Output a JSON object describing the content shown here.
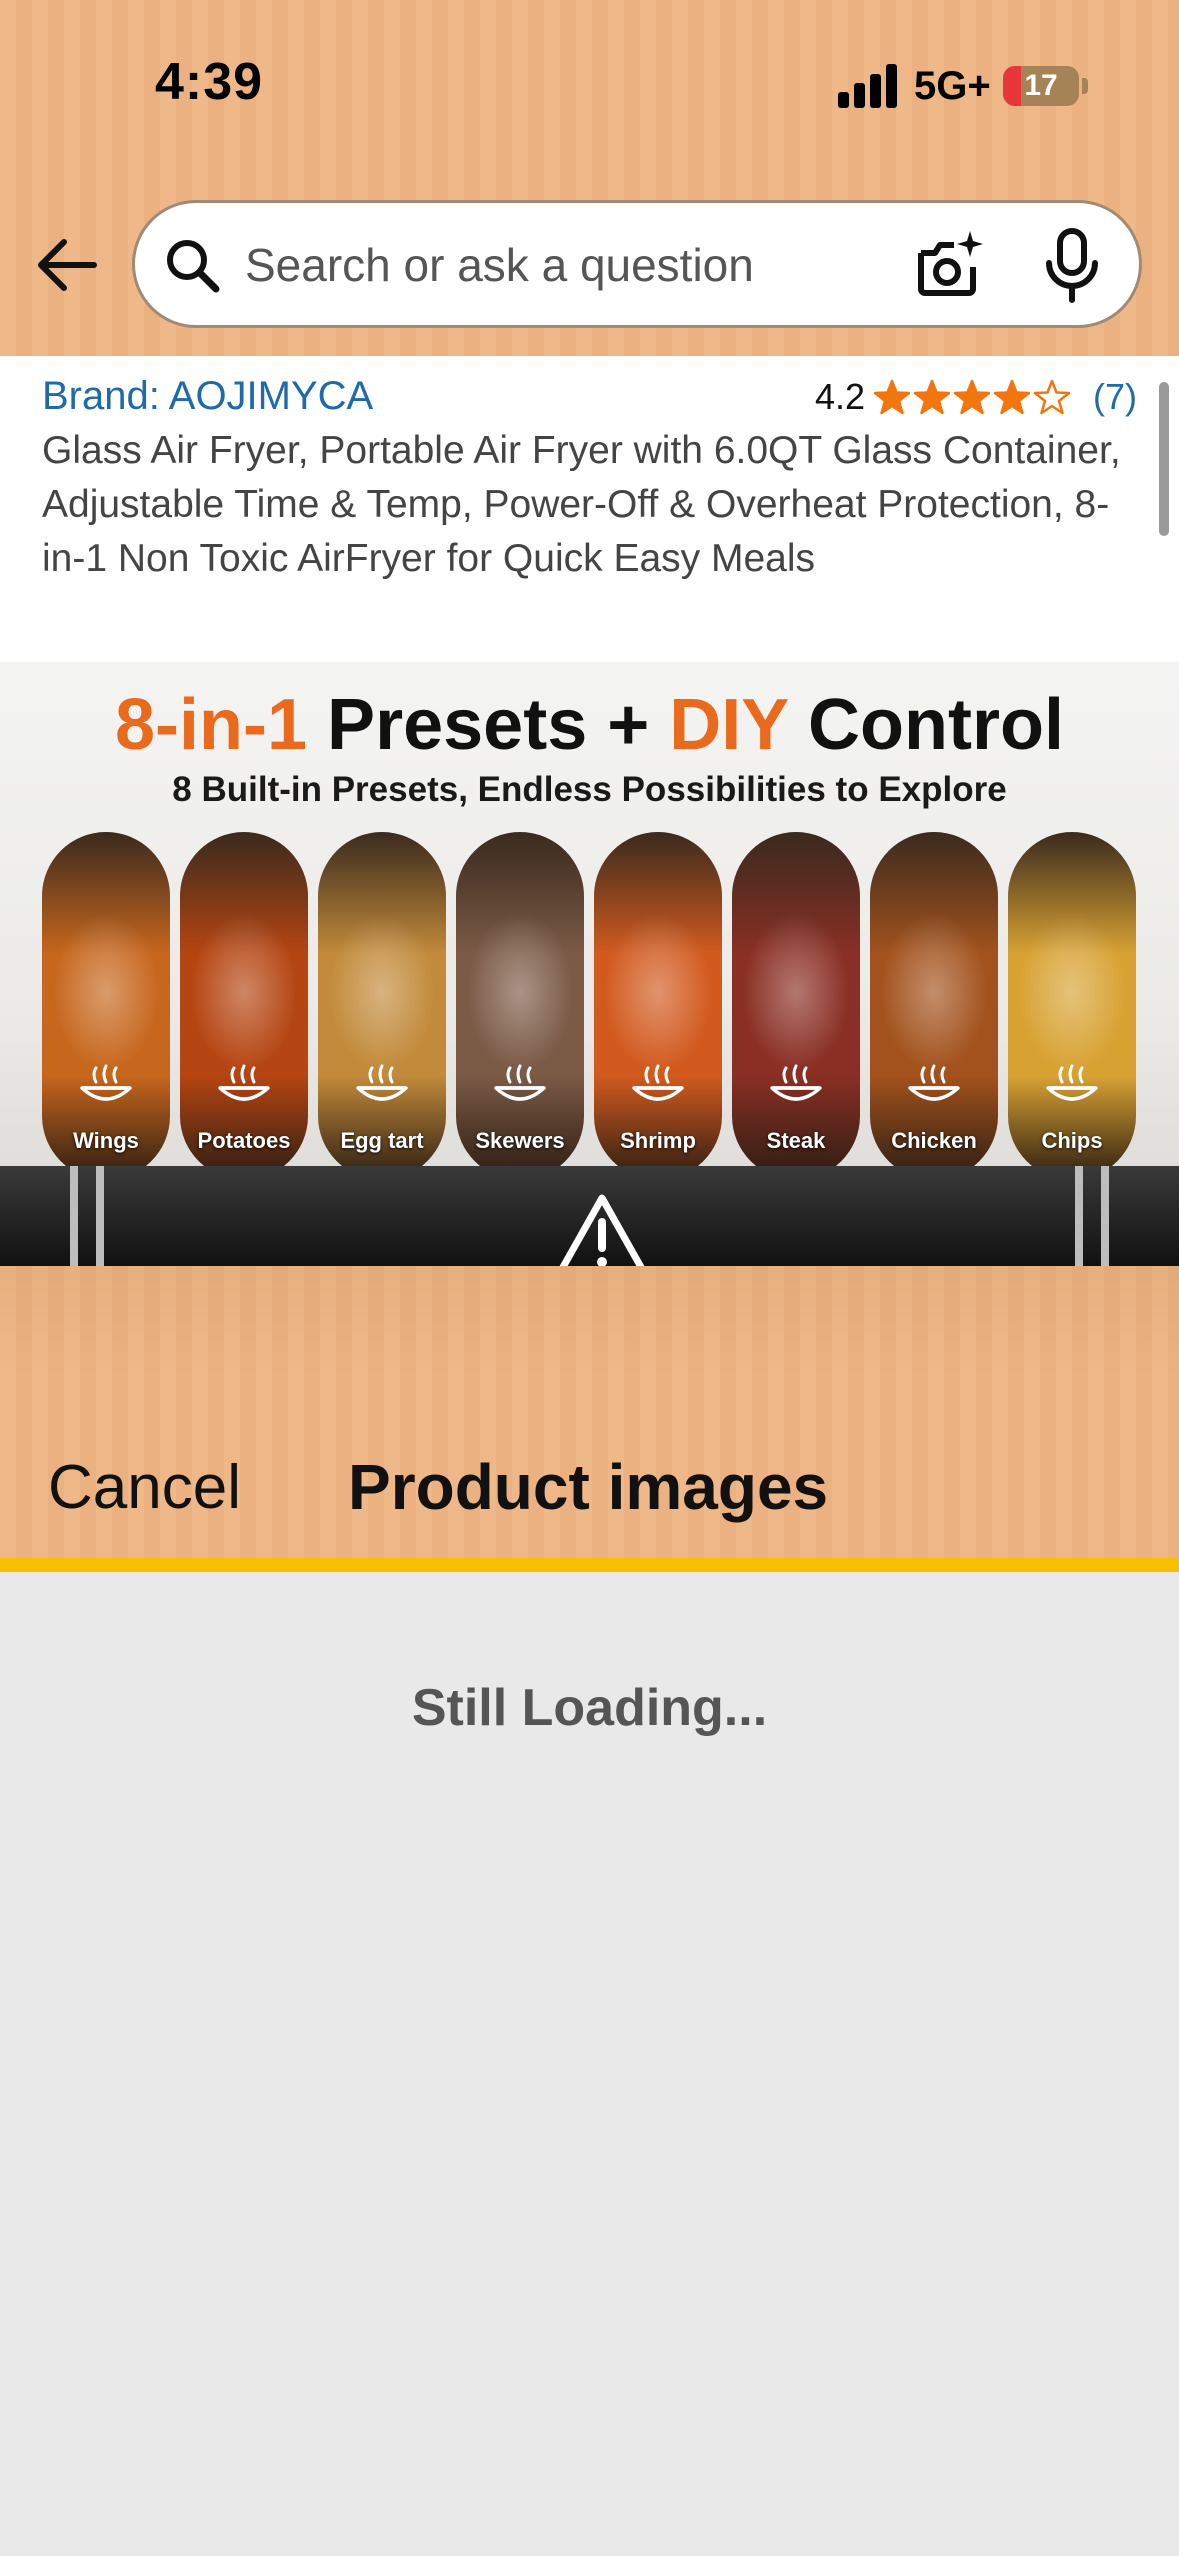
{
  "status_bar": {
    "time": "4:39",
    "network": "5G+",
    "battery": "17",
    "battery_color": "#e8373b"
  },
  "header": {
    "search_placeholder": "Search or ask a question",
    "back_icon": "arrow-left-icon",
    "camera_icon": "camera-sparkle-icon",
    "mic_icon": "microphone-icon"
  },
  "product": {
    "brand": "Brand: AOJIMYCA",
    "rating_value": "4.2",
    "stars_filled": 4,
    "stars_total": 5,
    "review_count": "(7)",
    "title": "Glass Air Fryer, Portable Air Fryer with 6.0QT Glass Container, Adjustable Time & Temp, Power-Off & Overheat Protection, 8-in-1 Non Toxic AirFryer for Quick Easy Meals",
    "star_color": "#f2760d",
    "link_color": "#1f6aa9"
  },
  "hero_image": {
    "title_a": "8-in-1",
    "title_b": " Presets + ",
    "title_c": "DIY",
    "title_d": " Control",
    "subtitle": "8 Built-in Presets, Endless Possibilities to Explore",
    "accent_color": "#ea6a1d",
    "presets": [
      {
        "label": "Wings",
        "color": "#c7661d"
      },
      {
        "label": "Potatoes",
        "color": "#b54512"
      },
      {
        "label": "Egg tart",
        "color": "#c28a3a"
      },
      {
        "label": "Skewers",
        "color": "#7b5a46"
      },
      {
        "label": "Shrimp",
        "color": "#d25a1f"
      },
      {
        "label": "Steak",
        "color": "#8a2f24"
      },
      {
        "label": "Chicken",
        "color": "#a3521d"
      },
      {
        "label": "Chips",
        "color": "#d8a233"
      }
    ]
  },
  "sheet": {
    "cancel_label": "Cancel",
    "title": "Product images",
    "loading_text": "Still Loading...",
    "accent_line_color": "#f7c000"
  }
}
